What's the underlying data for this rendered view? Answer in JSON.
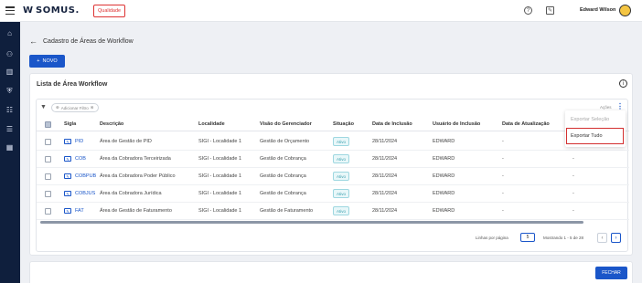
{
  "app": {
    "logo_mark": "W",
    "logo_text": "SOMUS.",
    "environment_badge": "Qualidade",
    "user_name": "Edward Wilson",
    "help_icon": "help-circle-icon",
    "notification_icon": "announcement-icon"
  },
  "sidebar": {
    "items": [
      {
        "icon": "home-icon",
        "glyph": "⌂"
      },
      {
        "icon": "users-icon",
        "glyph": "⚇"
      },
      {
        "icon": "library-icon",
        "glyph": "▥"
      },
      {
        "icon": "shield-icon",
        "glyph": "⛨"
      },
      {
        "icon": "list-settings-icon",
        "glyph": "☷"
      },
      {
        "icon": "list-check-icon",
        "glyph": "☰"
      },
      {
        "icon": "grid-icon",
        "glyph": "▦"
      }
    ]
  },
  "page": {
    "title": "Cadastro de Áreas de Workflow",
    "new_button": "NOVO"
  },
  "list": {
    "title": "Lista de Área Workflow",
    "add_filter": "Adicionar Filtro",
    "actions_label": "Ações",
    "columns": [
      "Sigla",
      "Descrição",
      "Localidade",
      "Visão do Gerenciador",
      "Situação",
      "Data de Inclusão",
      "Usuário de Inclusão",
      "Data de Atualização"
    ],
    "rows": [
      {
        "sigla": "PID",
        "descricao": "Área de Gestão de PID",
        "localidade": "SIGI - Localidade 1",
        "visao": "Gestão de Orçamento",
        "situacao": "Ativo",
        "data_inclusao": "28/11/2024",
        "usuario": "EDWARD",
        "data_atualizacao": "-",
        "extra": "-"
      },
      {
        "sigla": "COB",
        "descricao": "Área da Cobradora Terceirizada",
        "localidade": "SIGI - Localidade 1",
        "visao": "Gestão de Cobrança",
        "situacao": "Ativo",
        "data_inclusao": "28/11/2024",
        "usuario": "EDWARD",
        "data_atualizacao": "-",
        "extra": "-"
      },
      {
        "sigla": "COBPUB",
        "descricao": "Área da Cobradora Poder Público",
        "localidade": "SIGI - Localidade 1",
        "visao": "Gestão de Cobrança",
        "situacao": "Ativo",
        "data_inclusao": "28/11/2024",
        "usuario": "EDWARD",
        "data_atualizacao": "-",
        "extra": "-"
      },
      {
        "sigla": "COBJUS",
        "descricao": "Área da Cobradora Jurídica",
        "localidade": "SIGI - Localidade 1",
        "visao": "Gestão de Cobrança",
        "situacao": "Ativo",
        "data_inclusao": "28/11/2024",
        "usuario": "EDWARD",
        "data_atualizacao": "-",
        "extra": "-"
      },
      {
        "sigla": "FAT",
        "descricao": "Área de Gestão de Faturamento",
        "localidade": "SIGI - Localidade 1",
        "visao": "Gestão de Faturamento",
        "situacao": "Ativo",
        "data_inclusao": "28/11/2024",
        "usuario": "EDWARD",
        "data_atualizacao": "-",
        "extra": "-"
      }
    ],
    "pagination": {
      "rows_per_page_label": "Linhas por página",
      "rows_per_page": "5",
      "info": "Mostrando 1 - 5 de 28"
    }
  },
  "actions_menu": {
    "export_selection": "Exportar Seleção",
    "export_all": "Exportar Tudo"
  },
  "footer": {
    "close_button": "FECHAR"
  },
  "colors": {
    "primary": "#1a56c9",
    "sidebar": "#0f1f3d",
    "status_active": "#3a9fae",
    "highlight": "#d32f2f"
  }
}
